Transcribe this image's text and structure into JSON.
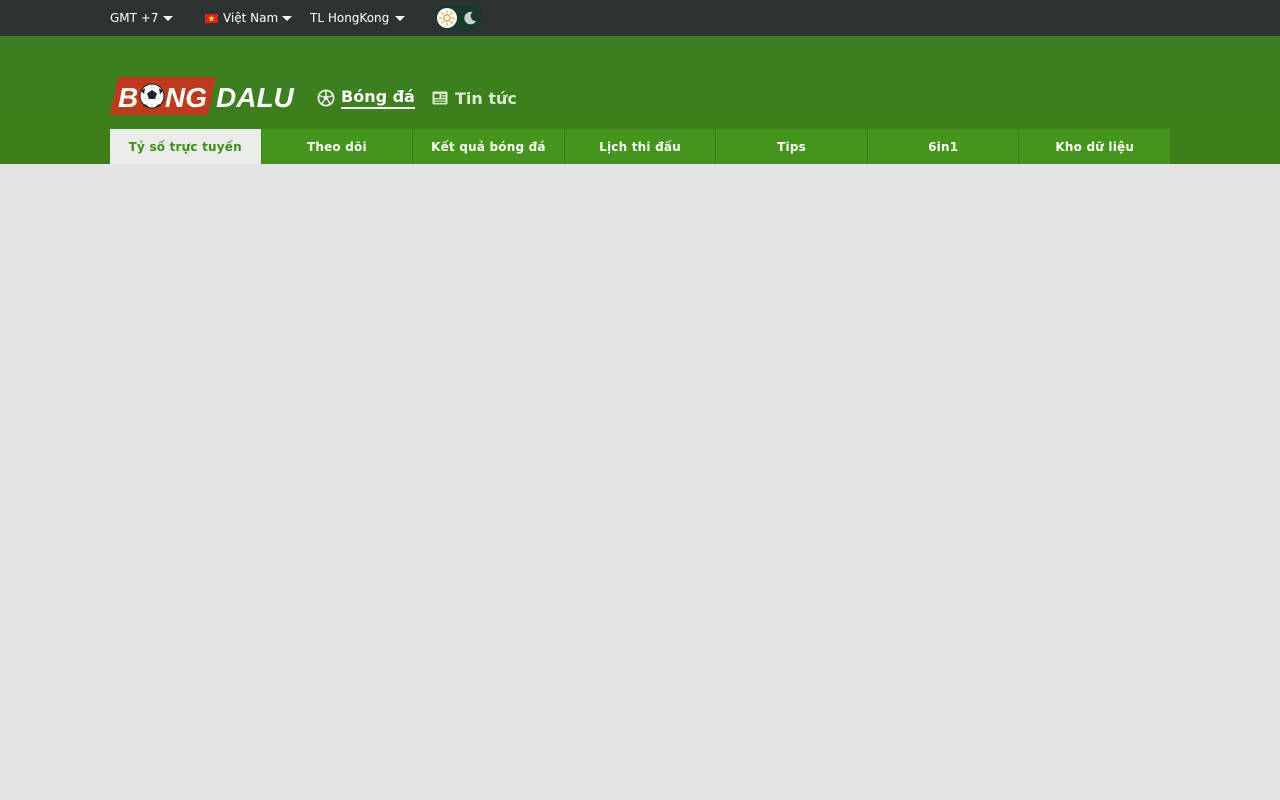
{
  "topbar": {
    "timezone": "GMT +7",
    "language": "Việt Nam",
    "odds_type": "TL HongKong",
    "theme_toggle": {
      "light_icon": "sun-icon",
      "dark_icon": "moon-icon",
      "mode": "light"
    }
  },
  "header": {
    "logo_text_left": "B",
    "logo_text_mid": "NG",
    "logo_text_right": "DALU",
    "nav": [
      {
        "label": "Bóng đá",
        "icon": "soccer-ball-icon",
        "active": true
      },
      {
        "label": "Tin tức",
        "icon": "newspaper-icon",
        "active": false
      }
    ]
  },
  "tabs": [
    {
      "label": "Tỷ số trực tuyến",
      "active": true
    },
    {
      "label": "Theo dõi",
      "active": false
    },
    {
      "label": "Kết quả bóng đá",
      "active": false
    },
    {
      "label": "Lịch thi đấu",
      "active": false
    },
    {
      "label": "Tips",
      "active": false
    },
    {
      "label": "6in1",
      "active": false
    },
    {
      "label": "Kho dữ liệu",
      "active": false
    }
  ],
  "colors": {
    "topbar_bg": "#2d3331",
    "header_bg": "#3c7f1a",
    "tab_bg": "#44951d",
    "tab_active_bg": "#e9ece8",
    "tab_active_text": "#3e8e1a",
    "page_bg": "#e4e4e4",
    "logo_red": "#c0391b"
  }
}
